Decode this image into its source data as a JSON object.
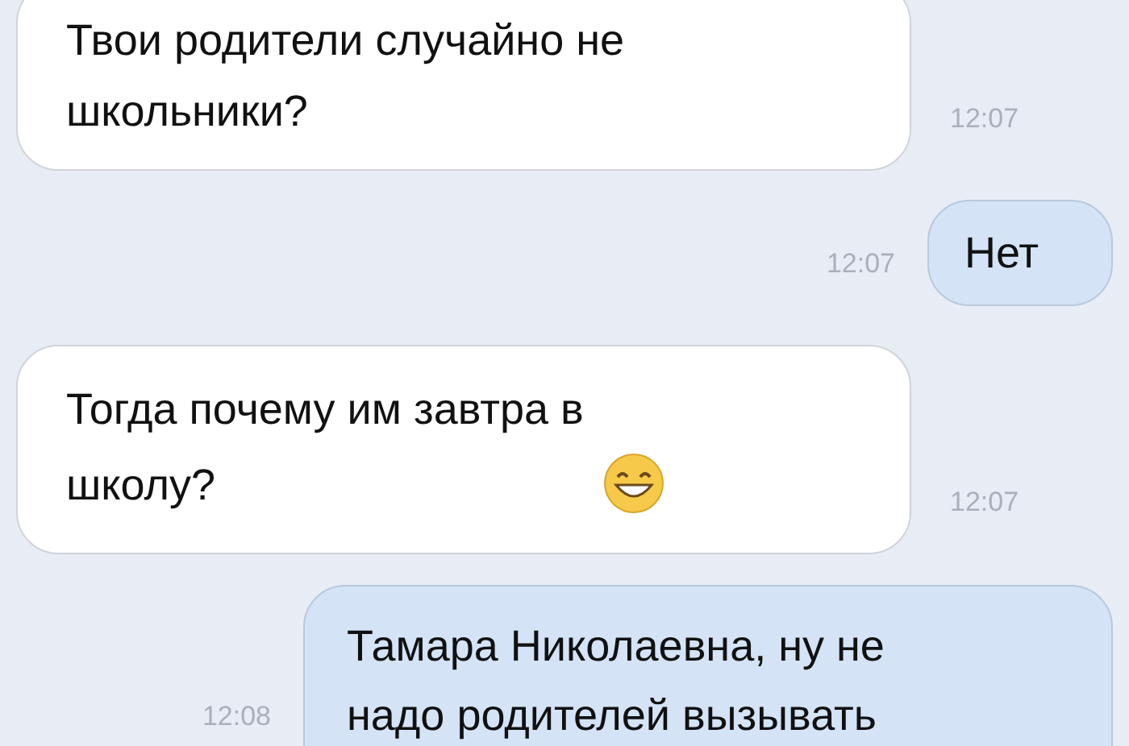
{
  "messages": [
    {
      "kind": "incoming",
      "text": "Твои родители случайно не\nшкольники?",
      "time": "12:07",
      "emoji": false
    },
    {
      "kind": "outgoing",
      "text": "Нет",
      "time": "12:07",
      "emoji": false
    },
    {
      "kind": "incoming",
      "text": "Тогда почему им завтра в\nшколу?",
      "time": "12:07",
      "emoji": true
    },
    {
      "kind": "outgoing",
      "text": "Тамара Николаевна, ну не\nнадо родителей вызывать",
      "time": "12:08",
      "emoji": false
    }
  ]
}
